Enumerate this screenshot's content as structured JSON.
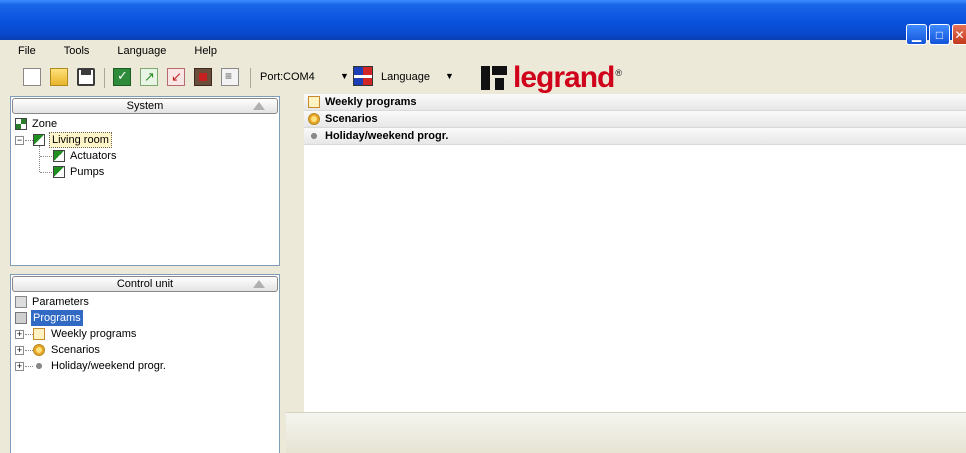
{
  "menu": {
    "items": [
      "File",
      "Tools",
      "Language",
      "Help"
    ]
  },
  "toolbar": {
    "port_label": "Port:",
    "port_value": "COM4",
    "language_label": "Language",
    "logo_text": "legrand",
    "logo_reg": "®"
  },
  "system_panel": {
    "title": "System",
    "tree": {
      "zone": "Zone",
      "living_room": "Living room",
      "actuators": "Actuators",
      "pumps": "Pumps"
    }
  },
  "control_panel": {
    "title": "Control unit",
    "tree": {
      "parameters": "Parameters",
      "programs": "Programs",
      "weekly": "Weekly programs",
      "scenarios": "Scenarios",
      "holiday": "Holiday/weekend progr."
    }
  },
  "right_list": {
    "items": [
      "Weekly programs",
      "Scenarios",
      "Holiday/weekend progr."
    ]
  },
  "colors": {
    "title_bar": "#0a54df",
    "selection": "#316ac5",
    "logo_red": "#d0021b"
  }
}
